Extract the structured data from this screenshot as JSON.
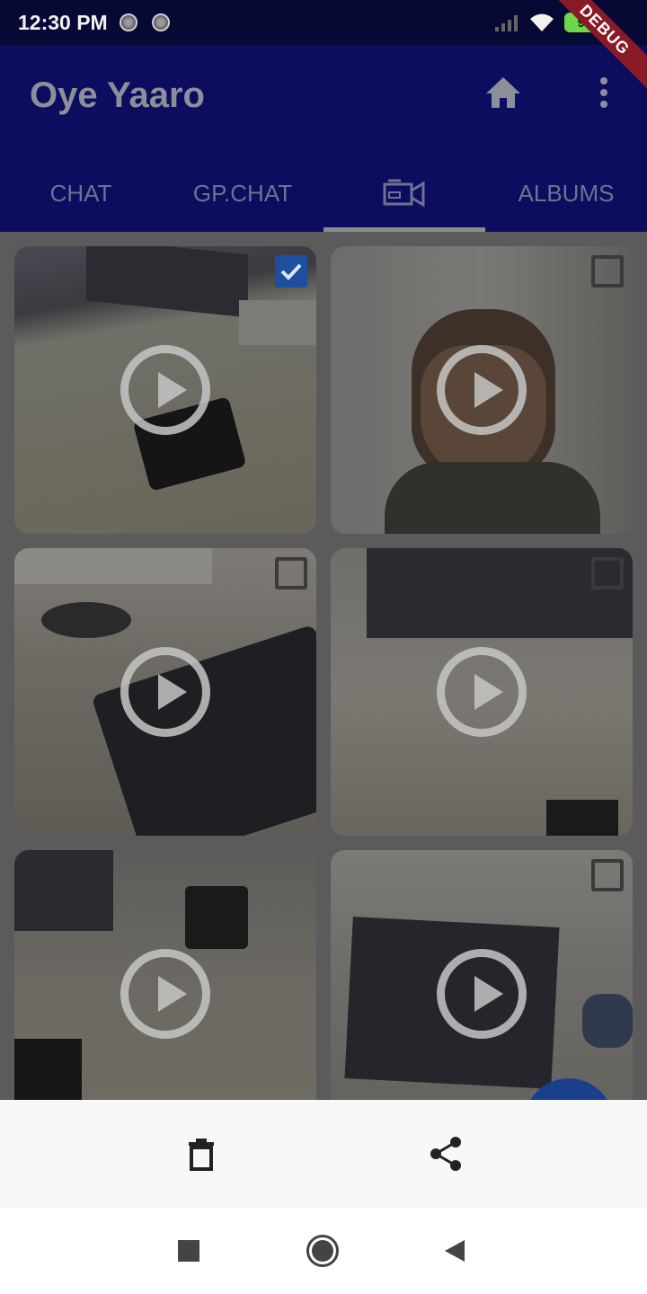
{
  "status_bar": {
    "time": "12:30 PM",
    "battery": "91",
    "debug_label": "DEBUG"
  },
  "app_bar": {
    "title": "Oye Yaaro"
  },
  "tabs": [
    {
      "label": "CHAT"
    },
    {
      "label": "GP.CHAT"
    },
    {
      "label": "",
      "icon": "video-camera-icon"
    },
    {
      "label": "ALBUMS"
    }
  ],
  "grid_items": [
    {
      "type": "video",
      "selected": true
    },
    {
      "type": "video",
      "selected": false
    },
    {
      "type": "video",
      "selected": false
    },
    {
      "type": "video",
      "selected": false
    },
    {
      "type": "video",
      "selected": false
    },
    {
      "type": "video",
      "selected": false
    }
  ],
  "actions": {
    "delete_icon": "trash-icon",
    "share_icon": "share-icon"
  },
  "navigation": {
    "buttons": [
      "recents-square-icon",
      "home-circle-icon",
      "back-triangle-icon"
    ]
  },
  "colors": {
    "app_bar": "#0c0d5e",
    "status_bar": "#070935",
    "selection": "#1d4f9e",
    "debug": "#8a1a25"
  }
}
